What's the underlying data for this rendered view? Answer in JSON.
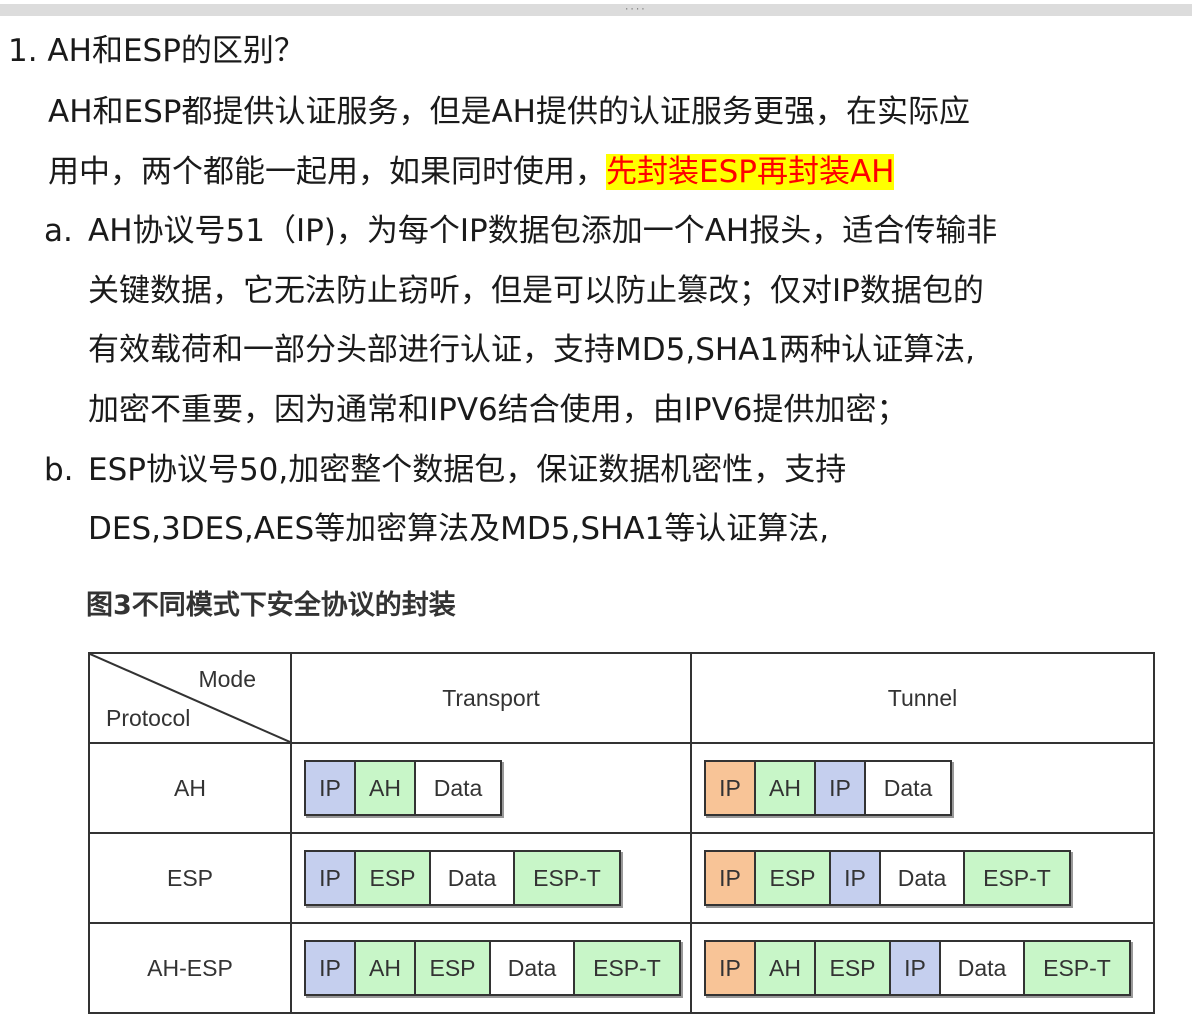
{
  "heading": "1. AH和ESP的区别？",
  "intro_line1": "AH和ESP都提供认证服务，但是AH提供的认证服务更强，在实际应",
  "intro_line2_plain": "用中，两个都能一起用，如果同时使用，",
  "intro_line2_highlight": "先封装ESP再封装AH",
  "item_a": {
    "marker": "a.",
    "lines": [
      "AH协议号51（IP)，为每个IP数据包添加一个AH报头，适合传输非",
      "关键数据，它无法防止窃听，但是可以防止篡改；仅对IP数据包的",
      "有效载荷和一部分头部进行认证，支持MD5,SHA1两种认证算法,",
      "加密不重要，因为通常和IPV6结合使用，由IPV6提供加密；"
    ]
  },
  "item_b": {
    "marker": "b.",
    "lines": [
      "ESP协议号50,加密整个数据包，保证数据机密性，支持",
      "DES,3DES,AES等加密算法及MD5,SHA1等认证算法,"
    ]
  },
  "figure": {
    "caption": "图3不同模式下安全协议的封装",
    "corner_mode": "Mode",
    "corner_protocol": "Protocol",
    "col_transport": "Transport",
    "col_tunnel": "Tunnel",
    "rows": [
      {
        "protocol": "AH",
        "transport": [
          {
            "label": "IP",
            "color": "#c5cfee"
          },
          {
            "label": "AH",
            "color": "#c8f6c8"
          },
          {
            "label": "Data",
            "color": "#ffffff"
          }
        ],
        "tunnel": [
          {
            "label": "IP",
            "color": "#f8c497"
          },
          {
            "label": "AH",
            "color": "#c8f6c8"
          },
          {
            "label": "IP",
            "color": "#c5cfee"
          },
          {
            "label": "Data",
            "color": "#ffffff"
          }
        ]
      },
      {
        "protocol": "ESP",
        "transport": [
          {
            "label": "IP",
            "color": "#c5cfee"
          },
          {
            "label": "ESP",
            "color": "#c8f6c8"
          },
          {
            "label": "Data",
            "color": "#ffffff"
          },
          {
            "label": "ESP-T",
            "color": "#c8f6c8"
          }
        ],
        "tunnel": [
          {
            "label": "IP",
            "color": "#f8c497"
          },
          {
            "label": "ESP",
            "color": "#c8f6c8"
          },
          {
            "label": "IP",
            "color": "#c5cfee"
          },
          {
            "label": "Data",
            "color": "#ffffff"
          },
          {
            "label": "ESP-T",
            "color": "#c8f6c8"
          }
        ]
      },
      {
        "protocol": "AH-ESP",
        "transport": [
          {
            "label": "IP",
            "color": "#c5cfee"
          },
          {
            "label": "AH",
            "color": "#c8f6c8"
          },
          {
            "label": "ESP",
            "color": "#c8f6c8"
          },
          {
            "label": "Data",
            "color": "#ffffff"
          },
          {
            "label": "ESP-T",
            "color": "#c8f6c8"
          }
        ],
        "tunnel": [
          {
            "label": "IP",
            "color": "#f8c497"
          },
          {
            "label": "AH",
            "color": "#c8f6c8"
          },
          {
            "label": "ESP",
            "color": "#c8f6c8"
          },
          {
            "label": "IP",
            "color": "#c5cfee"
          },
          {
            "label": "Data",
            "color": "#ffffff"
          },
          {
            "label": "ESP-T",
            "color": "#c8f6c8"
          }
        ]
      }
    ]
  }
}
